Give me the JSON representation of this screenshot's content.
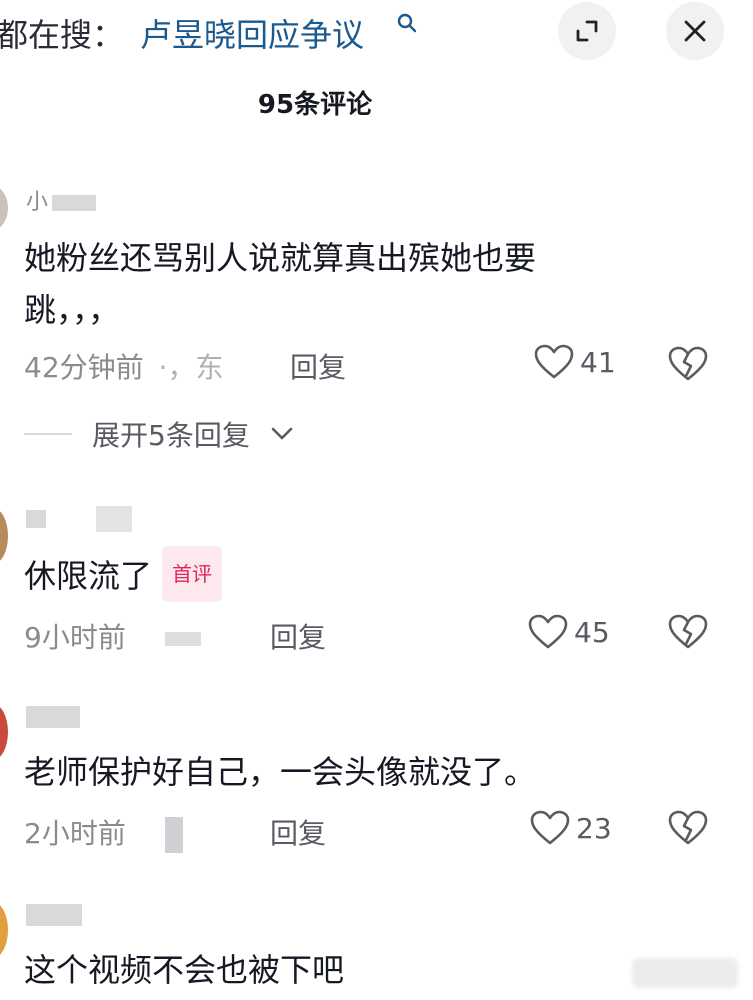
{
  "header": {
    "search_prefix": "都在搜：",
    "search_query": "卢昱晓回应争议",
    "icons": {
      "search": "search-icon",
      "expand": "expand-icon",
      "close": "close-icon"
    }
  },
  "comments_count_title": "95条评论",
  "comments": [
    {
      "author": "小",
      "text": "她粉丝还骂别人说就算真出殡她也要跳，，，",
      "time": "42分钟前",
      "location": "·，东",
      "reply_label": "回复",
      "likes": "41",
      "expand_replies": "展开5条回复"
    },
    {
      "author": "",
      "text": "休限流了",
      "badge": "首评",
      "time": "9小时前",
      "reply_label": "回复",
      "likes": "45"
    },
    {
      "author": "",
      "text": "老师保护好自己，一会头像就没了。",
      "time": "2小时前",
      "reply_label": "回复",
      "likes": "23"
    },
    {
      "author": "",
      "text": "这个视频不会也被下吧"
    }
  ],
  "colors": {
    "search_query": "#1b5a8f",
    "badge_text": "#e0245e",
    "badge_bg": "#fde8ee",
    "muted": "#8a8b91"
  }
}
